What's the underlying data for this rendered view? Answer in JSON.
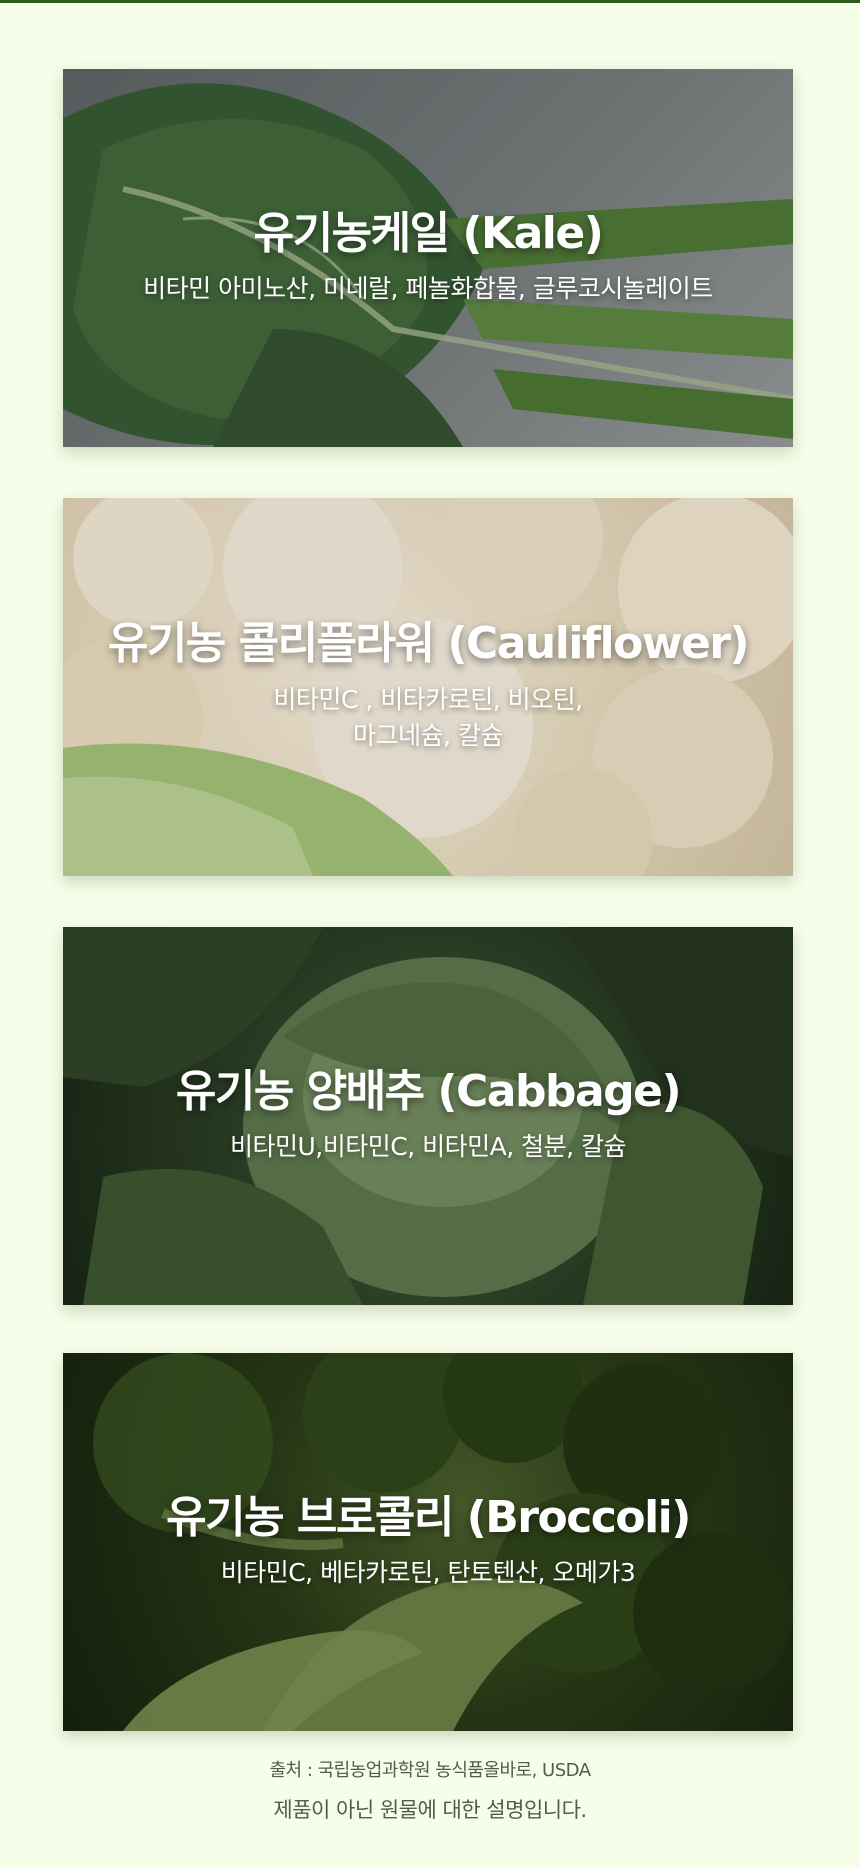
{
  "cards": [
    {
      "title": "유기농케일 (Kale)",
      "desc": "비타민 아미노산, 미네랄, 페놀화합물, 글루코시놀레이트"
    },
    {
      "title": "유기농 콜리플라워 (Cauliflower)",
      "desc": "비타민C , 비타카로틴, 비오틴,\n마그네슘, 칼슘"
    },
    {
      "title": "유기농 양배추 (Cabbage)",
      "desc": "비타민U,비타민C, 비타민A, 철분, 칼슘"
    },
    {
      "title": "유기농 브로콜리 (Broccoli)",
      "desc": "비타민C, 베타카로틴, 탄토텐산, 오메가3"
    }
  ],
  "footer": {
    "source": "출처 : 국립농업과학원 농식품올바로, USDA",
    "disclaimer": "제품이 아닌 원물에 대한 설명입니다."
  },
  "colors": {
    "page_background": "#f6fde9",
    "top_rule": "#2f5a1c",
    "card_text": "#ffffff",
    "footer_text": "#555a52"
  }
}
